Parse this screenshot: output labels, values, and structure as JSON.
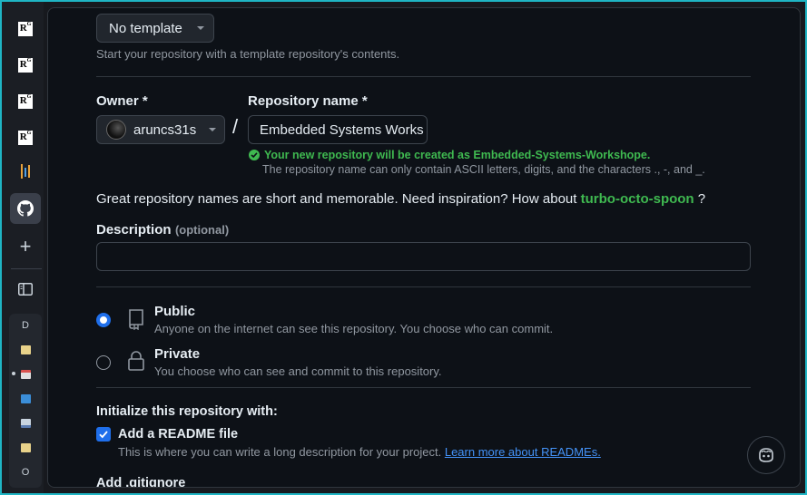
{
  "sidebar": {
    "items": [
      {
        "name": "rg-app-1",
        "glyph": "R"
      },
      {
        "name": "rg-app-2",
        "glyph": "R"
      },
      {
        "name": "rg-app-3",
        "glyph": "R"
      },
      {
        "name": "rg-app-4",
        "glyph": "R"
      }
    ],
    "rg_superscript": "G",
    "plus": "+",
    "sub_items": [
      {
        "label": "D"
      },
      {
        "label": "O"
      }
    ]
  },
  "template": {
    "button_label": "No template",
    "help": "Start your repository with a template repository's contents."
  },
  "owner": {
    "label": "Owner *",
    "value": "aruncs31s"
  },
  "separator": "/",
  "repo": {
    "label": "Repository name *",
    "value": "Embedded Systems Works",
    "success": "Your new repository will be created as Embedded-Systems-Workshope.",
    "rules": "The repository name can only contain ASCII letters, digits, and the characters  ., -, and _."
  },
  "inspiration": {
    "text": "Great repository names are short and memorable. Need inspiration? How about",
    "suggestion": "turbo-octo-spoon",
    "suffix": " ?"
  },
  "description": {
    "label": "Description",
    "optional": "(optional)",
    "value": ""
  },
  "visibility": {
    "public": {
      "title": "Public",
      "desc": "Anyone on the internet can see this repository. You choose who can commit.",
      "selected": true
    },
    "private": {
      "title": "Private",
      "desc": "You choose who can see and commit to this repository.",
      "selected": false
    }
  },
  "init": {
    "heading": "Initialize this repository with:",
    "readme_label": "Add a README file",
    "readme_checked": true,
    "readme_desc": "This is where you can write a long description for your project.",
    "readme_link": "Learn more about READMEs.",
    "gitignore_label": "Add .gitignore"
  },
  "colors": {
    "accent": "#1f6feb",
    "success": "#3fb950",
    "link": "#4493f8",
    "frame": "#1fb5c4"
  }
}
